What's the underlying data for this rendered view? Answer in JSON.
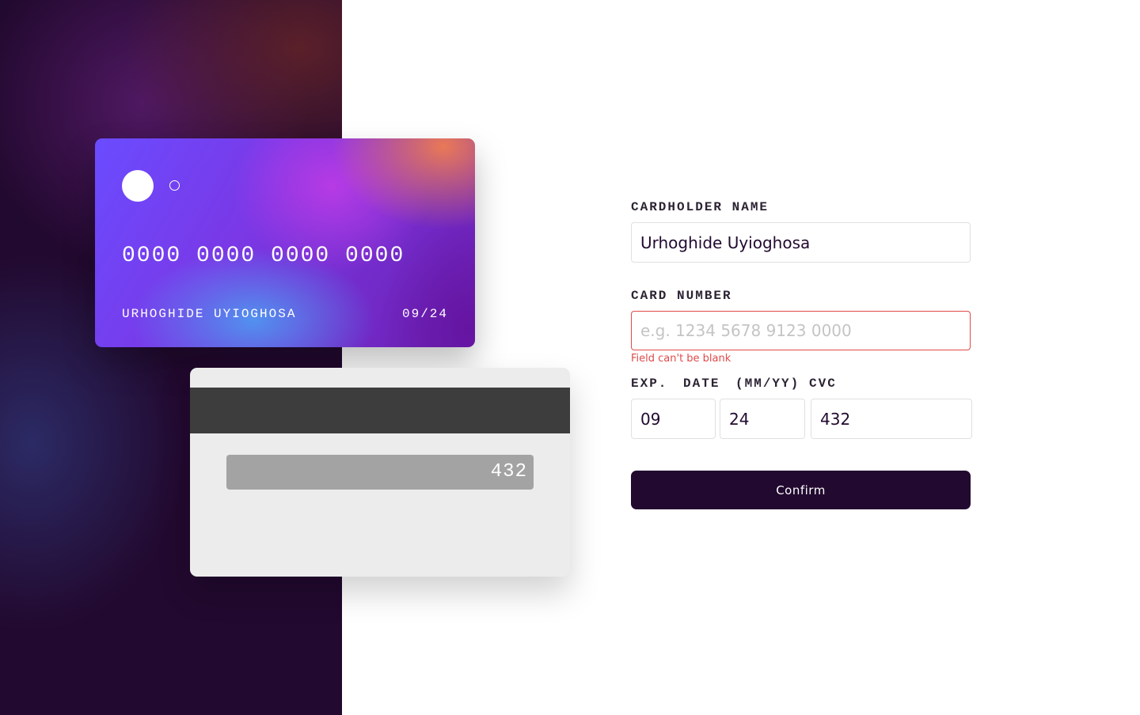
{
  "card_front": {
    "number": "0000 0000 0000 0000",
    "name": "URHOGHIDE UYIOGHOSA",
    "expiry": "09/24"
  },
  "card_back": {
    "cvc": "432"
  },
  "form": {
    "cardholder_label": "CARDHOLDER NAME",
    "cardholder_value": "Urhoghide Uyioghosa",
    "card_number_label": "CARD NUMBER",
    "card_number_value": "",
    "card_number_placeholder": "e.g. 1234 5678 9123 0000",
    "card_number_error": "Field can't be blank",
    "exp_label": "EXP. DATE (MM/YY)",
    "exp_month_value": "09",
    "exp_year_value": "24",
    "cvc_label": "CVC",
    "cvc_value": "432",
    "confirm_label": "Confirm"
  },
  "colors": {
    "dark_purple": "#21092f",
    "error_red": "#e04a4a"
  }
}
